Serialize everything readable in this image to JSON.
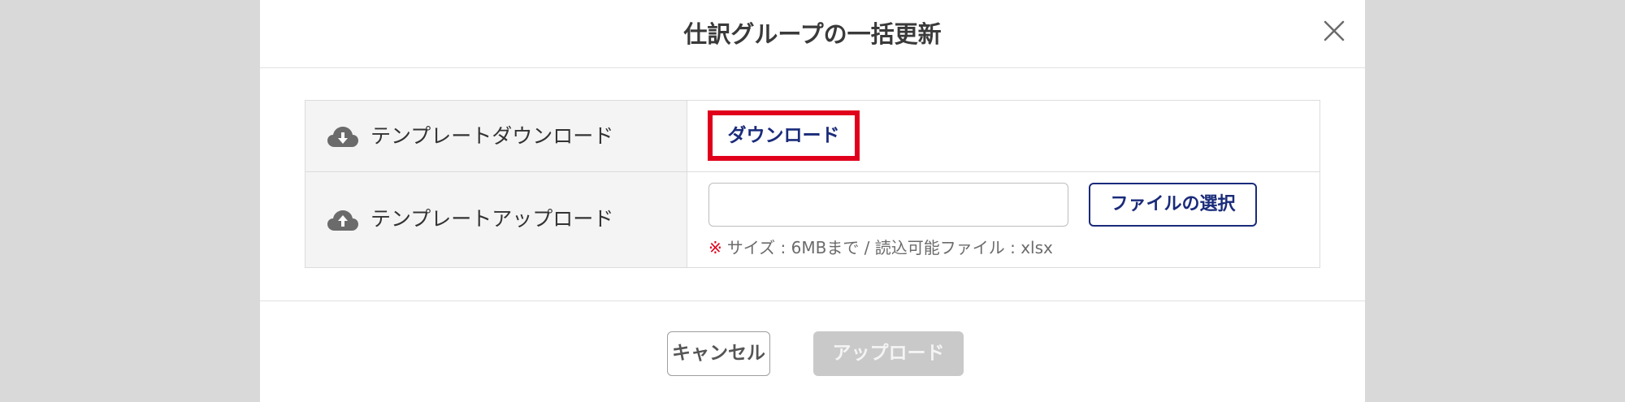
{
  "dialog": {
    "title": "仕訳グループの一括更新",
    "close_icon": "close-icon"
  },
  "template_download": {
    "label": "テンプレートダウンロード",
    "icon": "cloud-download-icon",
    "button_label": "ダウンロード"
  },
  "template_upload": {
    "label": "テンプレートアップロード",
    "icon": "cloud-upload-icon",
    "file_input_value": "",
    "select_button_label": "ファイルの選択",
    "note_mark": "※",
    "note_text": "サイズ : 6MBまで / 読込可能ファイル : xlsx"
  },
  "footer": {
    "cancel_label": "キャンセル",
    "upload_label": "アップロード"
  },
  "colors": {
    "accent_navy": "#1a2b7a",
    "highlight_red": "#e0001b",
    "disabled_gray": "#c9c9c9"
  }
}
